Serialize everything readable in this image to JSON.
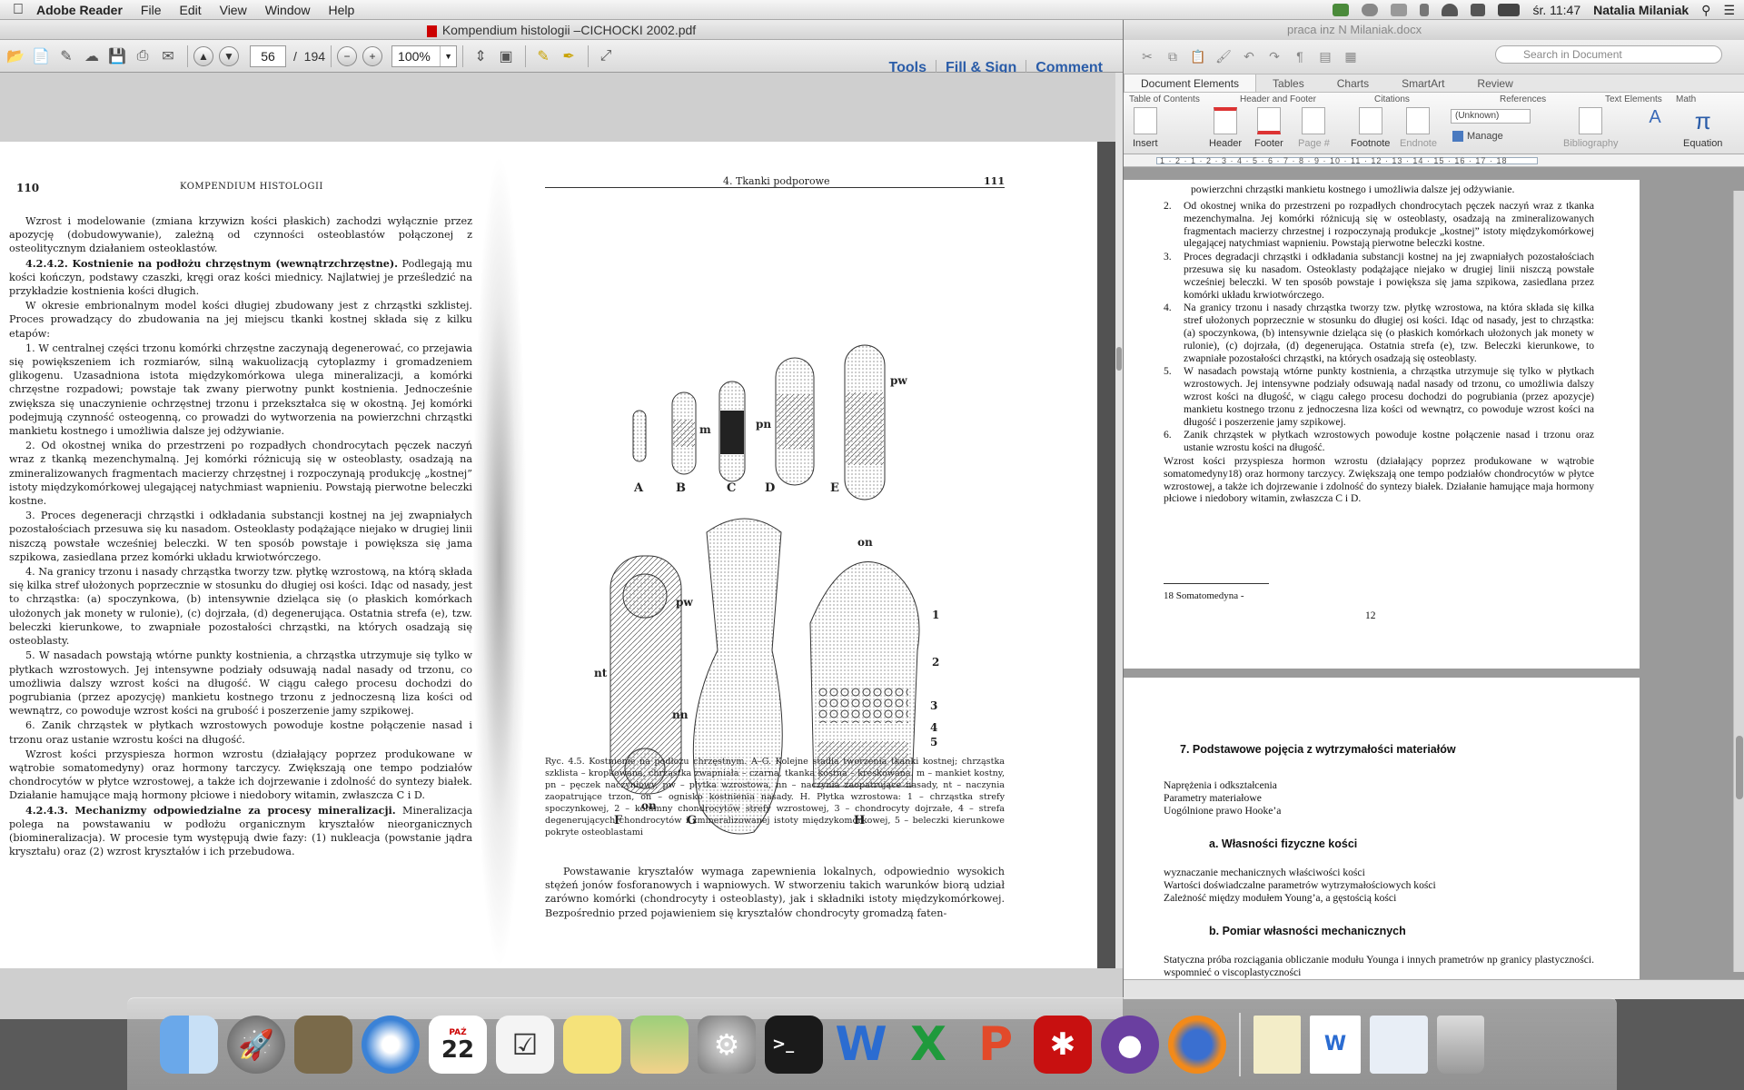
{
  "menubar": {
    "app": "Adobe Reader",
    "menus": [
      "File",
      "Edit",
      "View",
      "Window",
      "Help"
    ],
    "clock": "śr. 11:47",
    "user": "Natalia Milaniak"
  },
  "pdf": {
    "title": "Kompendium histologii –CICHOCKI 2002.pdf",
    "page_current": "56",
    "page_sep": "/",
    "page_total": "194",
    "zoom": "100%",
    "links": [
      "Tools",
      "Fill & Sign",
      "Comment"
    ],
    "left_page": {
      "number": "110",
      "header": "KOMPENDIUM HISTOLOGII",
      "p1": "Wzrost i modelowanie (zmiana krzywizn kości płaskich) zachodzi wyłącznie przez apozycję (dobudowywanie), zależną od czynności osteoblastów połączonej z osteolitycznym działaniem osteoklastów.",
      "h1": "4.2.4.2. Kostnienie na podłożu chrzęstnym (wewnątrzchrzęstne).",
      "h1_rest": "Podlegają mu kości kończyn, podstawy czaszki, kręgi oraz kości miednicy. Najlatwiej je prześledzić na przykładzie kostnienia kości długich.",
      "p2": "W okresie embrionalnym model kości długiej zbudowany jest z chrząstki szklistej. Proces prowadzący do zbudowania na jej miejscu tkanki kostnej składa się z kilku etapów:",
      "p3": "1. W centralnej części trzonu komórki chrzęstne zaczynają degenerować, co przejawia się powiększeniem ich rozmiarów, silną wakuolizacją cytoplazmy i gromadzeniem glikogenu. Uzasadniona istota międzykomórkowa ulega mineralizacji, a komórki chrzęstne rozpadowi; powstaje tak zwany pierwotny punkt kostnienia. Jednocześnie zwiększa się unaczynienie ochrzęstnej trzonu i przekształca się w okostną. Jej komórki podejmują czynność osteogenną, co prowadzi do wytworzenia na powierzchni chrząstki mankietu kostnego i umożliwia dalsze jej odżywianie.",
      "p4": "2. Od okostnej wnika do przestrzeni po rozpadłych chondrocytach pęczek naczyń wraz z tkanką mezenchymalną. Jej komórki różnicują się w osteoblasty, osadzają na zmineralizowanych fragmentach macierzy chrzęstnej i rozpoczynają produkcję „kostnej” istoty międzykomórkowej ulegającej natychmiast wapnieniu. Powstają pierwotne beleczki kostne.",
      "p5": "3. Proces degeneracji chrząstki i odkładania substancji kostnej na jej zwapniałych pozostałościach przesuwa się ku nasadom. Osteoklasty podążające niejako w drugiej linii niszczą powstałe wcześniej beleczki. W ten sposób powstaje i powiększa się jama szpikowa, zasiedlana przez komórki układu krwiotwórczego.",
      "p6": "4. Na granicy trzonu i nasady chrząstka tworzy tzw. płytkę wzrostową, na którą składa się kilka stref ułożonych poprzecznie w stosunku do długiej osi kości. Idąc od nasady, jest to chrząstka: (a) spoczynkowa, (b) intensywnie dzieląca się (o płaskich komórkach ułożonych jak monety w rulonie), (c) dojrzała, (d) degenerująca. Ostatnia strefa (e), tzw. beleczki kierunkowe, to zwapniałe pozostałości chrząstki, na których osadzają się osteoblasty.",
      "p7": "5. W nasadach powstają wtórne punkty kostnienia, a chrząstka utrzymuje się tylko w płytkach wzrostowych. Jej intensywne podziały odsuwają nadal nasady od trzonu, co umożliwia dalszy wzrost kości na długość. W ciągu całego procesu dochodzi do pogrubiania (przez apozycję) mankietu kostnego trzonu z jednoczesną liza kości od wewnątrz, co powoduje wzrost kości na grubość i poszerzenie jamy szpikowej.",
      "p8": "6. Zanik chrząstek w płytkach wzrostowych powoduje kostne połączenie nasad i trzonu oraz ustanie wzrostu kości na długość.",
      "p9": "Wzrost kości przyspiesza hormon wzrostu (działający poprzez produkowane w wątrobie somatomedyny) oraz hormony tarczycy. Zwiększają one tempo podziałów chondrocytów w płytce wzrostowej, a także ich dojrzewanie i zdolność do syntezy białek. Działanie hamujące mają hormony płciowe i niedobory witamin, zwłaszcza C i D.",
      "h2": "4.2.4.3. Mechanizmy odpowiedzialne za procesy mineralizacji.",
      "h2_rest": "Mineralizacja polega na powstawaniu w podłożu organicznym kryształów nieorganicznych (biomineralizacja). W procesie tym występują dwie fazy: (1) nukleacja (powstanie jądra kryształu) oraz (2) wzrost kryształów i ich przebudowa."
    },
    "right_page": {
      "number": "111",
      "header": "4. Tkanki podporowe",
      "figure_labels": [
        "A",
        "B",
        "C",
        "D",
        "E",
        "F",
        "G",
        "H"
      ],
      "figure_marks": [
        "m",
        "pn",
        "pw",
        "pw",
        "nt",
        "nn",
        "on",
        "on",
        "1",
        "2",
        "3",
        "4",
        "5"
      ],
      "caption": "Ryc. 4.5. Kostnienie na podłożu chrzęstnym. A–G. Kolejne stadia tworzenia tkanki kostnej; chrząstka szklista – kropkowana, chrząstka zwapniała – czarna, tkanka kostna – kreskowana. m – mankiet kostny, pn – pęczek naczyniowy, pw – płytka wzrostowa, nn – naczynia zaopatrujące nasady, nt – naczynia zaopatrujące trzon, on – ognisko kostnienia nasady. H. Płytka wzrostowa: 1 – chrząstka strefy spoczynkowej, 2 – kolumny chondrocytów strefy wzrostowej, 3 – chondrocyty dojrzałe, 4 – strefa degenerujących chondrocytów i zmineralizowanej istoty międzykomórkowej, 5 – beleczki kierunkowe pokryte osteoblastami",
      "body": "Powstawanie kryształów wymaga zapewnienia lokalnych, odpowiednio wysokich stężeń jonów fosforanowych i wapniowych. W stworzeniu takich warunków biorą udział zarówno komórki (chondrocyty i osteoblasty), jak i składniki istoty międzykomórkowej. Bezpośrednio przed pojawieniem się kryształów chondrocyty gromadzą faten-"
    }
  },
  "word": {
    "title": "praca inz N Milaniak.docx",
    "search_placeholder": "Search in Document",
    "tabs": [
      "Document Elements",
      "Tables",
      "Charts",
      "SmartArt",
      "Review"
    ],
    "groups": [
      "Table of Contents",
      "Header and Footer",
      "Citations",
      "References",
      "Text Elements",
      "Math"
    ],
    "buttons": [
      "Insert",
      "Header",
      "Footer",
      "Page #",
      "Footnote",
      "Endnote",
      "Manage",
      "Bibliography",
      "Equation"
    ],
    "style_select": "(Unknown)",
    "ruler": "1 · 2 · 1 · 2 · 3 · 4 · 5 · 6 · 7 · 8 · 9 · 10 · 11 · 12 · 13 · 14 · 15 · 16 · 17 · 18",
    "page1": {
      "top_line": "powierzchni chrząstki mankietu kostnego i umożliwia dalsze jej odżywianie.",
      "items": [
        "Od okostnej wnika do przestrzeni po rozpadłych chondrocytach pęczek naczyń wraz z tkanka mezenchymalna. Jej komórki różnicują się w osteoblasty, osadzają na zmineralizowanych fragmentach macierzy chrzestnej i rozpoczynają produkcje „kostnej” istoty międzykomórkowej ulegającej natychmiast wapnieniu. Powstają pierwotne beleczki kostne.",
        "Proces degradacji chrząstki i odkładania substancji kostnej na jej zwapniałych pozostałościach przesuwa się ku nasadom. Osteoklasty podążające niejako w drugiej linii niszczą powstałe wcześniej beleczki. W ten sposób powstaje i powiększa się jama szpikowa, zasiedlana przez komórki układu krwiotwórczego.",
        "Na granicy trzonu i nasady chrząstka tworzy tzw. płytkę wzrostowa, na która składa się kilka stref ułożonych poprzecznie w stosunku do długiej osi kości. Idąc od nasady, jest to chrząstka: (a) spoczynkowa, (b) intensywnie dzieląca się (o płaskich komórkach ułożonych jak monety w rulonie), (c) dojrzała, (d) degenerująca. Ostatnia strefa (e), tzw. Beleczki kierunkowe, to zwapniałe pozostałości chrząstki, na których osadzają się osteoblasty.",
        "W nasadach powstają wtórne punkty kostnienia, a chrząstka utrzymuje się tylko w płytkach wzrostowych. Jej intensywne podziały odsuwają nadal nasady od trzonu, co umożliwia dalszy wzrost kości na długość, w ciągu całego procesu dochodzi do pogrubiania (przez apozycje) mankietu kostnego trzonu z jednoczesna liza kości od wewnątrz, co powoduje wzrost kości na długość i poszerzenie jamy szpikowej.",
        "Zanik chrząstek w płytkach wzrostowych powoduje kostne połączenie nasad i trzonu oraz ustanie wzrostu kości na długość."
      ],
      "item_numbers": [
        "2.",
        "3.",
        "4.",
        "5.",
        "6."
      ],
      "para": "Wzrost kości przyspiesza hormon wzrostu (działający poprzez produkowane w wątrobie somatomedyny18) oraz hormony tarczycy. Zwiększają one tempo podziałów chondrocytów w płytce wzrostowej, a także ich dojrzewanie i zdolność do syntezy białek. Działanie hamujące maja hormony płciowe i niedobory witamin, zwłaszcza C i D.",
      "footnote": "18 Somatomedyna -",
      "page_number": "12"
    },
    "page2": {
      "heading7": "7.   Podstawowe pojęcia z wytrzymałości materiałów",
      "lines_a": [
        "Naprężenia i odkształcenia",
        "Parametry materiałowe",
        "Uogólnione prawo Hooke’a"
      ],
      "heading_a": "a.   Własności fizyczne kości",
      "lines_b": [
        "wyznaczanie mechanicznych właściwości kości",
        "Wartości doświadczalne parametrów wytrzymałościowych kości",
        "Zależność między modułem Young’a, a gęstością kości"
      ],
      "heading_b": "b.   Pomiar własności mechanicznych",
      "para": "Statyczna próba rozciągania obliczanie modułu Younga i innych prametrów np granicy plastyczności. wspomnieć o viscoplastyczności"
    }
  },
  "dock": {
    "calendar_month": "PAŹ",
    "calendar_day": "22"
  }
}
